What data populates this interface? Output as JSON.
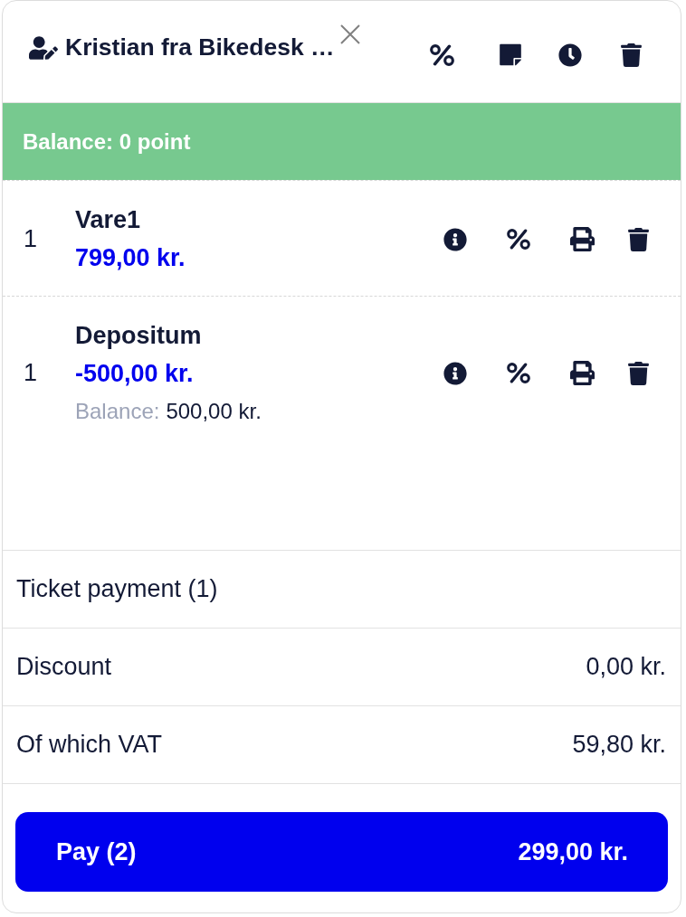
{
  "header": {
    "customer_name": "Kristian fra Bikedesk …"
  },
  "balance_banner": {
    "text": "Balance: 0 point"
  },
  "lines": [
    {
      "quantity": "1",
      "name": "Vare1",
      "price": "799,00 kr."
    },
    {
      "quantity": "1",
      "name": "Depositum",
      "price": "-500,00 kr.",
      "balance_label": "Balance:",
      "balance_value": "500,00 kr."
    }
  ],
  "summary": [
    {
      "label": "Ticket payment (1)"
    },
    {
      "label": "Discount",
      "value": "0,00 kr."
    },
    {
      "label": "Of which VAT",
      "value": "59,80 kr."
    }
  ],
  "pay_button": {
    "label": "Pay (2)",
    "amount": "299,00 kr."
  }
}
